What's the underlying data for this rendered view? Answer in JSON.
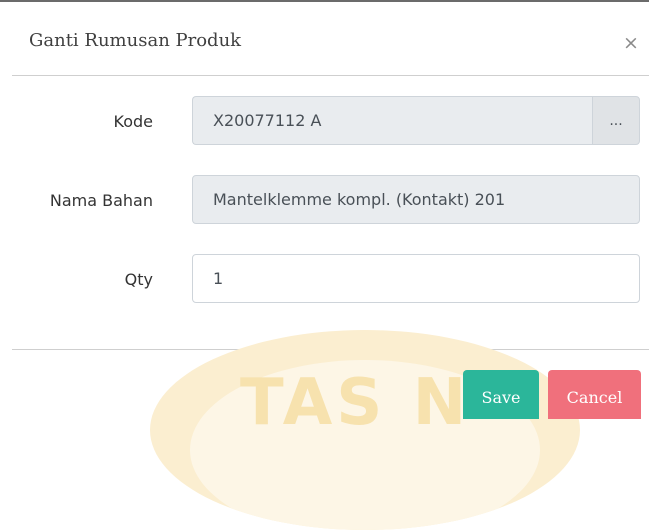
{
  "dialog": {
    "title": "Ganti Rumusan Produk",
    "close_glyph": "×"
  },
  "form": {
    "kode": {
      "label": "Kode",
      "value": "X20077112  A",
      "browse_label": "..."
    },
    "nama_bahan": {
      "label": "Nama Bahan",
      "value": "Mantelklemme kompl. (Kontakt) 201"
    },
    "qty": {
      "label": "Qty",
      "value": "1"
    }
  },
  "footer": {
    "save_label": "Save",
    "cancel_label": "Cancel"
  },
  "watermark": {
    "text": "TAS N"
  },
  "colors": {
    "save": "#2bb69a",
    "cancel": "#f0707c",
    "readonly_field": "#e9ecef",
    "watermark": "#f7e2ae"
  }
}
